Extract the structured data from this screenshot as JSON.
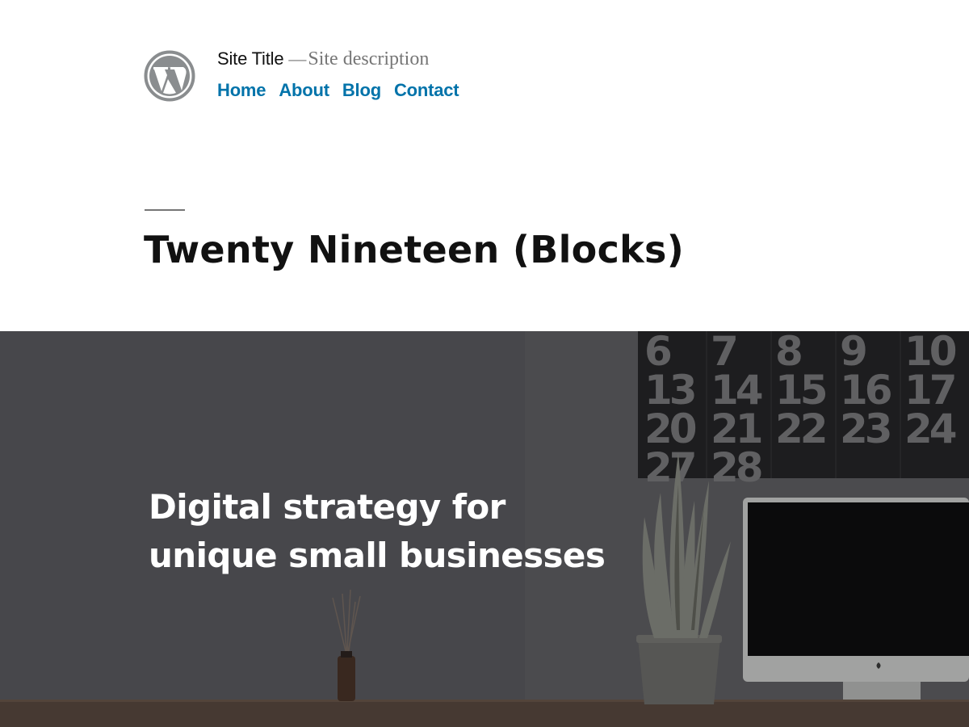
{
  "header": {
    "site_title": "Site Title",
    "separator": "—",
    "site_description": "Site description",
    "logo_icon": "wordpress-logo-icon"
  },
  "nav": {
    "items": [
      {
        "label": "Home"
      },
      {
        "label": "About"
      },
      {
        "label": "Blog"
      },
      {
        "label": "Contact"
      }
    ]
  },
  "page": {
    "title": "Twenty Nineteen (Blocks)"
  },
  "hero": {
    "heading_line1": "Digital strategy for",
    "heading_line2": "unique small businesses",
    "calendar_numbers": [
      "6",
      "7",
      "8",
      "9",
      "10",
      "13",
      "14",
      "15",
      "16",
      "17",
      "20",
      "21",
      "22",
      "23",
      "24",
      "27",
      "28"
    ]
  },
  "colors": {
    "link": "#0073aa",
    "muted": "#767676",
    "text": "#111111",
    "hero_overlay": "#5b5b5f"
  }
}
